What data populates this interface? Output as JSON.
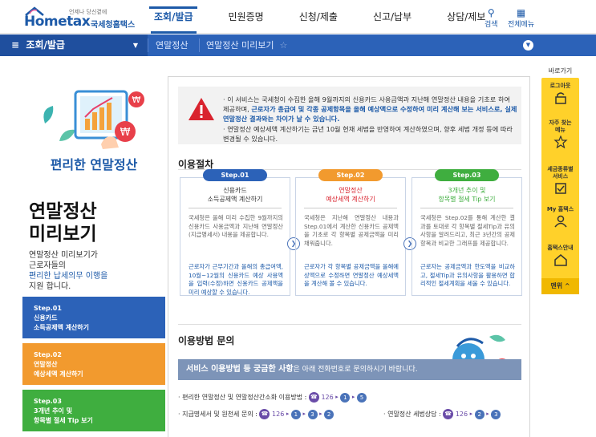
{
  "header": {
    "logo_sub": "언제나 당신곁에",
    "logo_main": "Hometax",
    "logo_kr": "국세청홈택스",
    "nav": [
      "조회/발급",
      "민원증명",
      "신청/제출",
      "신고/납부",
      "상담/제보"
    ],
    "search_label": "검색",
    "allmenu_label": "전체메뉴"
  },
  "subbar": {
    "menu_label": "조회/발급",
    "crumb1": "연말정산",
    "crumb2": "연말정산 미리보기"
  },
  "left": {
    "small_title": "편리한 연말정산",
    "big_title_line1": "연말정산",
    "big_title_line2": "미리보기",
    "intro_line1": "연말정산 미리보기가",
    "intro_line2": "근로자들의",
    "intro_line3": "편리한 납세의무 이행을",
    "intro_line4": "지원 합니다.",
    "steps": [
      {
        "l1": "Step.01",
        "l2": "신용카드",
        "l3": "소득공제액 계산하기"
      },
      {
        "l1": "Step.02",
        "l2": "연말정산",
        "l3": "예상세액 계산하기"
      },
      {
        "l1": "Step.03",
        "l2": "3개년 추이 및",
        "l3": "항목별 절세 Tip 보기"
      }
    ]
  },
  "notice": {
    "p1a": "· 이 서비스는 국세청이 수집한 올해 9월까지의 신용카드 사용금액과 지난해 연말정산 내용을 기초로 하여 제공하며, ",
    "p1b": "근로자가 총급여 및 각종 공제항목을 올해 예상액으로 수정하여 미리 계산해 보는 서비스로, 실제 연말정산 결과와는 차이가 날 수 있습니다.",
    "p2": "· 연말정산 예상세액 계산하기는 금년 10월 현재 세법을 반영하여 계산하였으며, 향후 세법 개정 등에 따라 변경될 수 있습니다."
  },
  "procedure": {
    "title": "이용절차",
    "boxes": [
      {
        "pill": "Step.01",
        "head1": "신용카드",
        "head2": "소득공제액 계산하기",
        "t1": "국세청은 올해 미리 수집한 9월까지의 신용카드 사용금액과 지난해 연말정산(지급명세서) 내용을 제공합니다.",
        "t2": "근로자가 근무기간과 올해의 총급여액, 10월~12월의 신용카드 예상 사용액을 입력(수정)하면 신용카드 공제액을 미리 예상할 수 있습니다."
      },
      {
        "pill": "Step.02",
        "head1": "연말정산",
        "head2": "예상세액 계산하기",
        "t1": "국세청은 지난해 연말정산 내용과 Step.01에서 계산한 신용카드 공제액을 기초로 각 항목별 공제금액을 미리 채워줍니다.",
        "t2": "근로자가 각 항목별 공제금액을 올해예상액으로 수정하면 연말정산 예상세액을 계산해 볼 수 있습니다."
      },
      {
        "pill": "Step.03",
        "head1": "3개년 추이 및",
        "head2": "항목별 절세 Tip 보기",
        "t1": "국세청은 Step.02를 통해 계산한 결과를 토대로 각 항목별 절세Tip과 유의사항을 알려드리고, 최근 3년간의 공제항목과 비교한 그래프를 제공합니다.",
        "t2": "근로자는 공제금액과 한도액을 비교하고, 절세Tip과 유의사항을 활용하면 합리적인 절세계획을 세울 수 있습니다."
      }
    ]
  },
  "inquiry": {
    "title": "이용방법 문의",
    "banner_bold": "서비스 이용방법 등 궁금한 사항",
    "banner_rest": "은 아래 전화번호로 문의하시기 바랍니다.",
    "line1_label": "· 편리한 연말정산 및 연말정산간소화 이용방법 :",
    "line1_num": "126",
    "line1_d1": "1",
    "line1_d2": "5",
    "line2_label": "· 지급명세서 및 원천세 문의 :",
    "line2_num": "126",
    "line2_d1": "1",
    "line2_d2": "3",
    "line2_d3": "2",
    "line3_label": "· 연말정산 세법상담 :",
    "line3_num": "126",
    "line3_d1": "2",
    "line3_d2": "3"
  },
  "quick": {
    "title": "바로가기",
    "items": [
      "로그아웃",
      "자주 찾는",
      "메뉴",
      "세금종류별",
      "서비스",
      "My 홈택스",
      "홈택스안내"
    ],
    "top": "맨위 ^"
  },
  "colors": {
    "brand_blue": "#1d5aa8",
    "step1": "#2c62b8",
    "step2": "#f29a2e",
    "step3": "#3fae3f",
    "quick_yellow": "#ffd12a"
  }
}
